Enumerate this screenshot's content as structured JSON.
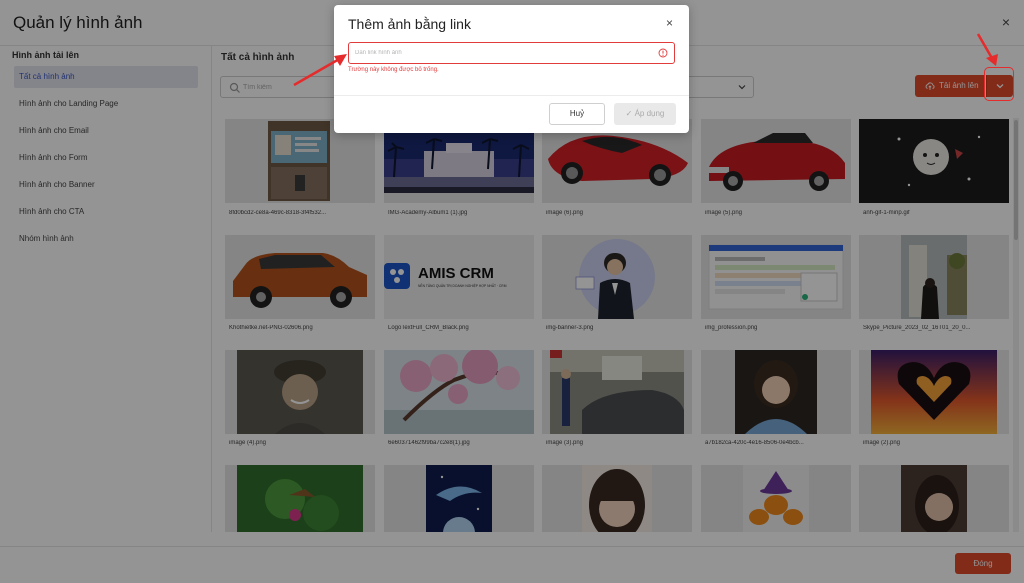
{
  "app": {
    "title": "Quản lý hình ảnh",
    "close_icon": "×"
  },
  "sidebar": {
    "heading": "Hình ảnh tải lên",
    "items": [
      {
        "label": "Tất cả hình ảnh",
        "active": true
      },
      {
        "label": "Hình ảnh cho Landing Page",
        "active": false
      },
      {
        "label": "Hình ảnh cho Email",
        "active": false
      },
      {
        "label": "Hình ảnh cho Form",
        "active": false
      },
      {
        "label": "Hình ảnh cho Banner",
        "active": false
      },
      {
        "label": "Hình ảnh cho CTA",
        "active": false
      },
      {
        "label": "Nhóm hình ảnh",
        "active": false
      }
    ]
  },
  "main": {
    "title": "Tất cả hình ảnh",
    "search_placeholder": "Tìm kiếm",
    "upload_label": "Tải ảnh lên",
    "footer_close": "Đóng"
  },
  "images": [
    {
      "name": "8fd0bcd2-ce8a-469c-8318-3f4f532...",
      "icon": "id-card-photo"
    },
    {
      "name": "IMG-Academy-Album1 (1).jpg",
      "icon": "building-night-photo"
    },
    {
      "name": "image (6).png",
      "icon": "red-sports-car"
    },
    {
      "name": "image (5).png",
      "icon": "red-convertible-car"
    },
    {
      "name": "anh-gif-1-minp.gif",
      "icon": "moon-character-gif"
    },
    {
      "name": "Khothietke.net-PNG-02606.png",
      "icon": "orange-suv"
    },
    {
      "name": "LogoTextFull_CRM_Black.png",
      "icon": "amis-crm-logo"
    },
    {
      "name": "img-banner-3.png",
      "icon": "businessman-banner"
    },
    {
      "name": "img_profession.png",
      "icon": "dashboard-screenshot"
    },
    {
      "name": "Skype_Picture_2023_02_16T01_20_0...",
      "icon": "street-photo"
    },
    {
      "name": "image (4).png",
      "icon": "smiling-boy-photo"
    },
    {
      "name": "6e60371462f99ba7c2e8(1).jpg",
      "icon": "blossom-tree-painting"
    },
    {
      "name": "image (3).png",
      "icon": "garage-photo"
    },
    {
      "name": "a7b182ca-420c-4e16-8506-0e4bcb...",
      "icon": "girl-portrait"
    },
    {
      "name": "image (2).png",
      "icon": "heart-hands-sunset"
    },
    {
      "name": "",
      "icon": "green-fantasy-art"
    },
    {
      "name": "",
      "icon": "blue-fantasy-art"
    },
    {
      "name": "",
      "icon": "girl-close-up"
    },
    {
      "name": "",
      "icon": "halloween-pumpkins"
    },
    {
      "name": "",
      "icon": "woman-portrait"
    }
  ],
  "logo_text": {
    "brand": "AMIS CRM",
    "tagline": "NỀN TẢNG QUẢN TRỊ DOANH NGHIỆP HỢP NHẤT · CRM"
  },
  "dialog": {
    "title": "Thêm ảnh bằng link",
    "input_placeholder": "Dán link hình ảnh",
    "error": "Trường này không được bỏ trống.",
    "cancel": "Huỷ",
    "apply": "Áp dụng"
  },
  "colors": {
    "accent": "#e04b2c",
    "active_item_bg": "#e3e6ee",
    "active_item_text": "#3a55c8",
    "error": "#e23b3b",
    "annotation": "#e52b2b"
  }
}
